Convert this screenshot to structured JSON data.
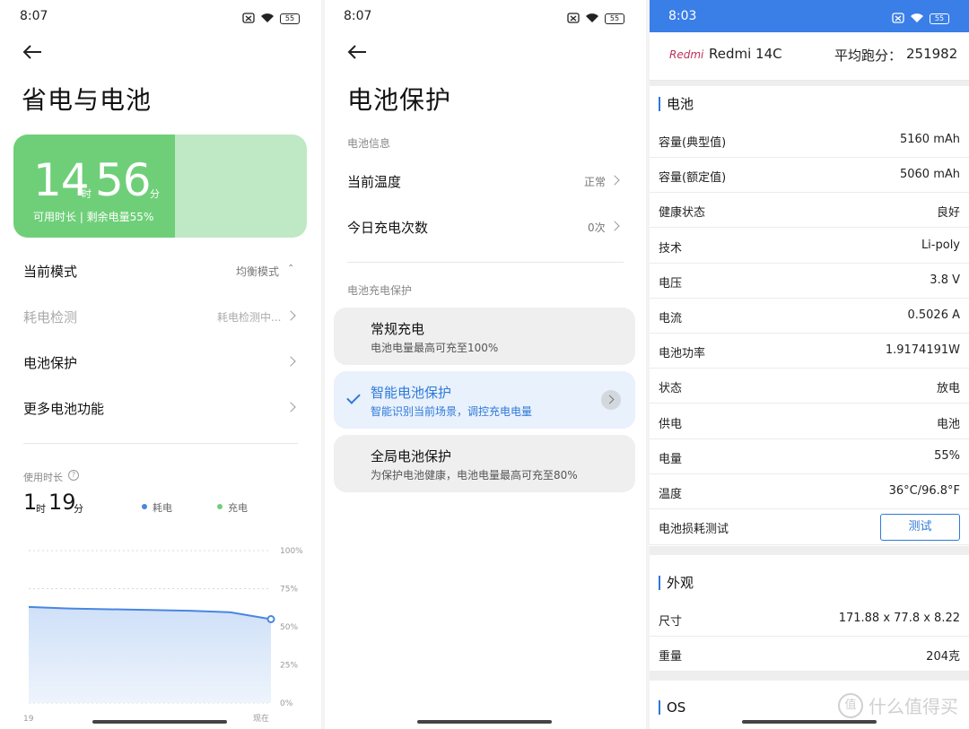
{
  "panel1": {
    "status_time": "8:07",
    "battery_level": "55",
    "title": "省电与电池",
    "card": {
      "hours": "14",
      "hours_unit": "时",
      "minutes": "56",
      "minutes_unit": "分",
      "subtitle": "可用时长 | 剩余电量55%",
      "remaining_percent": 55
    },
    "rows": [
      {
        "label": "当前模式",
        "value": "均衡模式"
      },
      {
        "label": "耗电检测",
        "value": "耗电检测中..."
      },
      {
        "label": "电池保护",
        "value": ""
      },
      {
        "label": "更多电池功能",
        "value": ""
      }
    ],
    "usage": {
      "label": "使用时长",
      "hours": "1",
      "hours_unit": "时",
      "minutes": "19",
      "minutes_unit": "分",
      "legend_drain": "耗电",
      "legend_charge": "充电"
    },
    "chart_data": {
      "type": "area",
      "y_ticks": [
        "100%",
        "75%",
        "50%",
        "25%",
        "0%"
      ],
      "x_ticks": [
        "19",
        "现在"
      ],
      "ylim": [
        0,
        100
      ],
      "series": [
        {
          "name": "耗电",
          "values": [
            63,
            62,
            61.5,
            61,
            60.5,
            59.5,
            55
          ]
        }
      ],
      "colors": {
        "drain": "#4a86e0",
        "charge": "#6fcf79"
      }
    }
  },
  "panel2": {
    "status_time": "8:07",
    "battery_level": "55",
    "title": "电池保护",
    "info_header": "电池信息",
    "info_rows": [
      {
        "label": "当前温度",
        "value": "正常"
      },
      {
        "label": "今日充电次数",
        "value": "0次"
      }
    ],
    "protect_header": "电池充电保护",
    "options": [
      {
        "title": "常规充电",
        "sub": "电池电量最高可充至100%"
      },
      {
        "title": "智能电池保护",
        "sub": "智能识别当前场景，调控充电电量"
      },
      {
        "title": "全局电池保护",
        "sub": "为保护电池健康，电池电量最高可充至80%"
      }
    ]
  },
  "panel3": {
    "status_time": "8:03",
    "battery_level": "55",
    "brand": "Redmi",
    "model": "Redmi 14C",
    "score_label": "平均跑分：",
    "score": "251982",
    "battery_section": "电池",
    "battery_rows": [
      {
        "k": "容量(典型值)",
        "v": "5160 mAh"
      },
      {
        "k": "容量(额定值)",
        "v": "5060 mAh"
      },
      {
        "k": "健康状态",
        "v": "良好"
      },
      {
        "k": "技术",
        "v": "Li-poly"
      },
      {
        "k": "电压",
        "v": "3.8 V"
      },
      {
        "k": "电流",
        "v": "0.5026 A"
      },
      {
        "k": "电池功率",
        "v": "1.9174191W"
      },
      {
        "k": "状态",
        "v": "放电"
      },
      {
        "k": "供电",
        "v": "电池"
      },
      {
        "k": "电量",
        "v": "55%"
      },
      {
        "k": "温度",
        "v": "36°C/96.8°F"
      }
    ],
    "loss_test_label": "电池损耗测试",
    "loss_test_button": "测试",
    "appearance_section": "外观",
    "appearance_rows": [
      {
        "k": "尺寸",
        "v": "171.88 x 77.8 x 8.22"
      },
      {
        "k": "重量",
        "v": "204克"
      }
    ],
    "os_section": "OS"
  },
  "watermark": {
    "logo": "值",
    "text": "什么值得买"
  }
}
